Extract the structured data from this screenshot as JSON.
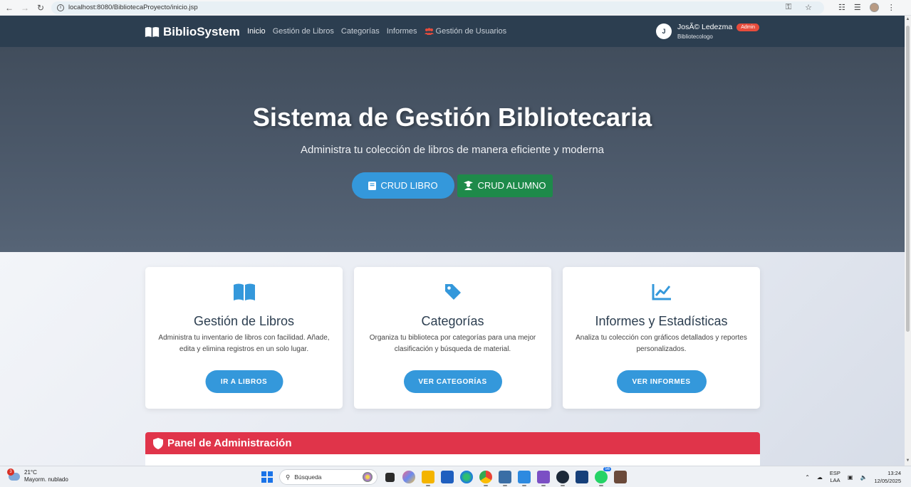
{
  "browser": {
    "url": "localhost:8080/BibliotecaProyecto/inicio.jsp"
  },
  "navbar": {
    "brand": "BiblioSystem",
    "links": [
      {
        "label": "Inicio",
        "active": true
      },
      {
        "label": "Gestión de Libros"
      },
      {
        "label": "Categorías"
      },
      {
        "label": "Informes"
      }
    ],
    "users_link": "Gestión de Usuarios",
    "user": {
      "initial": "J",
      "name": "JosÃ© Ledezma",
      "badge": "Admin",
      "role": "Bibliotecologo"
    }
  },
  "hero": {
    "title": "Sistema de Gestión Bibliotecaria",
    "subtitle": "Administra tu colección de libros de manera eficiente y moderna",
    "btn_libro": "CRUD LIBRO",
    "btn_alumno": "CRUD ALUMNO"
  },
  "cards": [
    {
      "title": "Gestión de Libros",
      "desc": "Administra tu inventario de libros con facilidad. Añade, edita y elimina registros en un solo lugar.",
      "button": "IR A LIBROS",
      "icon": "book-open-icon"
    },
    {
      "title": "Categorías",
      "desc": "Organiza tu biblioteca por categorías para una mejor clasificación y búsqueda de material.",
      "button": "VER CATEGORÍAS",
      "icon": "tag-icon"
    },
    {
      "title": "Informes y Estadísticas",
      "desc": "Analiza tu colección con gráficos detallados y reportes personalizados.",
      "button": "VER INFORMES",
      "icon": "chart-line-icon"
    }
  ],
  "admin_panel": {
    "title": "Panel de Administración"
  },
  "taskbar": {
    "weather_badge": "3",
    "temperature": "21°C",
    "weather_desc": "Mayorm. nublado",
    "search_placeholder": "Búsqueda",
    "whatsapp_badge": "56",
    "lang_top": "ESP",
    "lang_bottom": "LAA",
    "time": "13:24",
    "date": "12/05/2025"
  },
  "colors": {
    "navbar": "#2c3e50",
    "primary": "#3498db",
    "success": "#1e8a4a",
    "danger": "#e0344a"
  }
}
